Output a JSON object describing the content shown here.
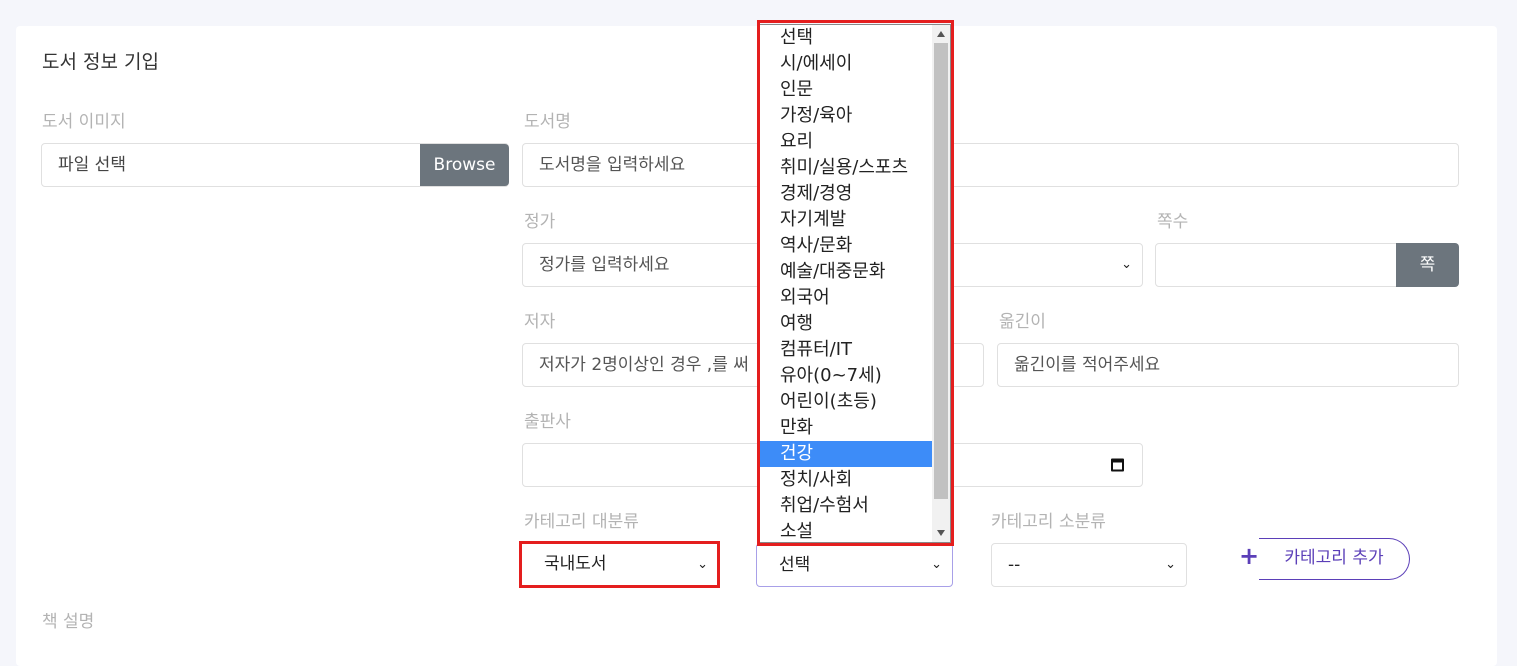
{
  "form": {
    "title": "도서 정보 기입",
    "image_label": "도서 이미지",
    "file_input_value": "파일 선택",
    "browse_label": "Browse",
    "book_name_label": "도서명",
    "book_name_placeholder": "도서명을 입력하세요",
    "price_label": "정가",
    "price_placeholder": "정가를 입력하세요",
    "pages_label": "쪽수",
    "pages_unit_label": "쪽",
    "author_label": "저자",
    "author_placeholder": "저자가 2명이상인 경우 ,를 써",
    "translator_label": "옮긴이",
    "translator_placeholder": "옮긴이를 적어주세요",
    "publisher_label": "출판사",
    "category_major_label": "카테고리 대분류",
    "category_major_value": "국내도서",
    "category_middle_value": "선택",
    "category_minor_label": "카테고리 소분류",
    "category_minor_value": "--",
    "add_category_label": "카테고리 추가",
    "description_label": "책 설명"
  },
  "dropdown": {
    "options": [
      "선택",
      "시/에세이",
      "인문",
      "가정/육아",
      "요리",
      "취미/실용/스포츠",
      "경제/경영",
      "자기계발",
      "역사/문화",
      "예술/대중문화",
      "외국어",
      "여행",
      "컴퓨터/IT",
      "유아(0~7세)",
      "어린이(초등)",
      "만화",
      "건강",
      "정치/사회",
      "취업/수험서",
      "소설"
    ],
    "highlighted": "건강"
  },
  "colors": {
    "highlight": "#e41e1e",
    "accent": "#5b3fb8",
    "selected_option": "#3d8cf8",
    "button_gray": "#6c757d"
  },
  "icons": {
    "select_chevron": "chevron-down-icon",
    "date_picker": "calendar-icon",
    "add": "plus-icon"
  }
}
